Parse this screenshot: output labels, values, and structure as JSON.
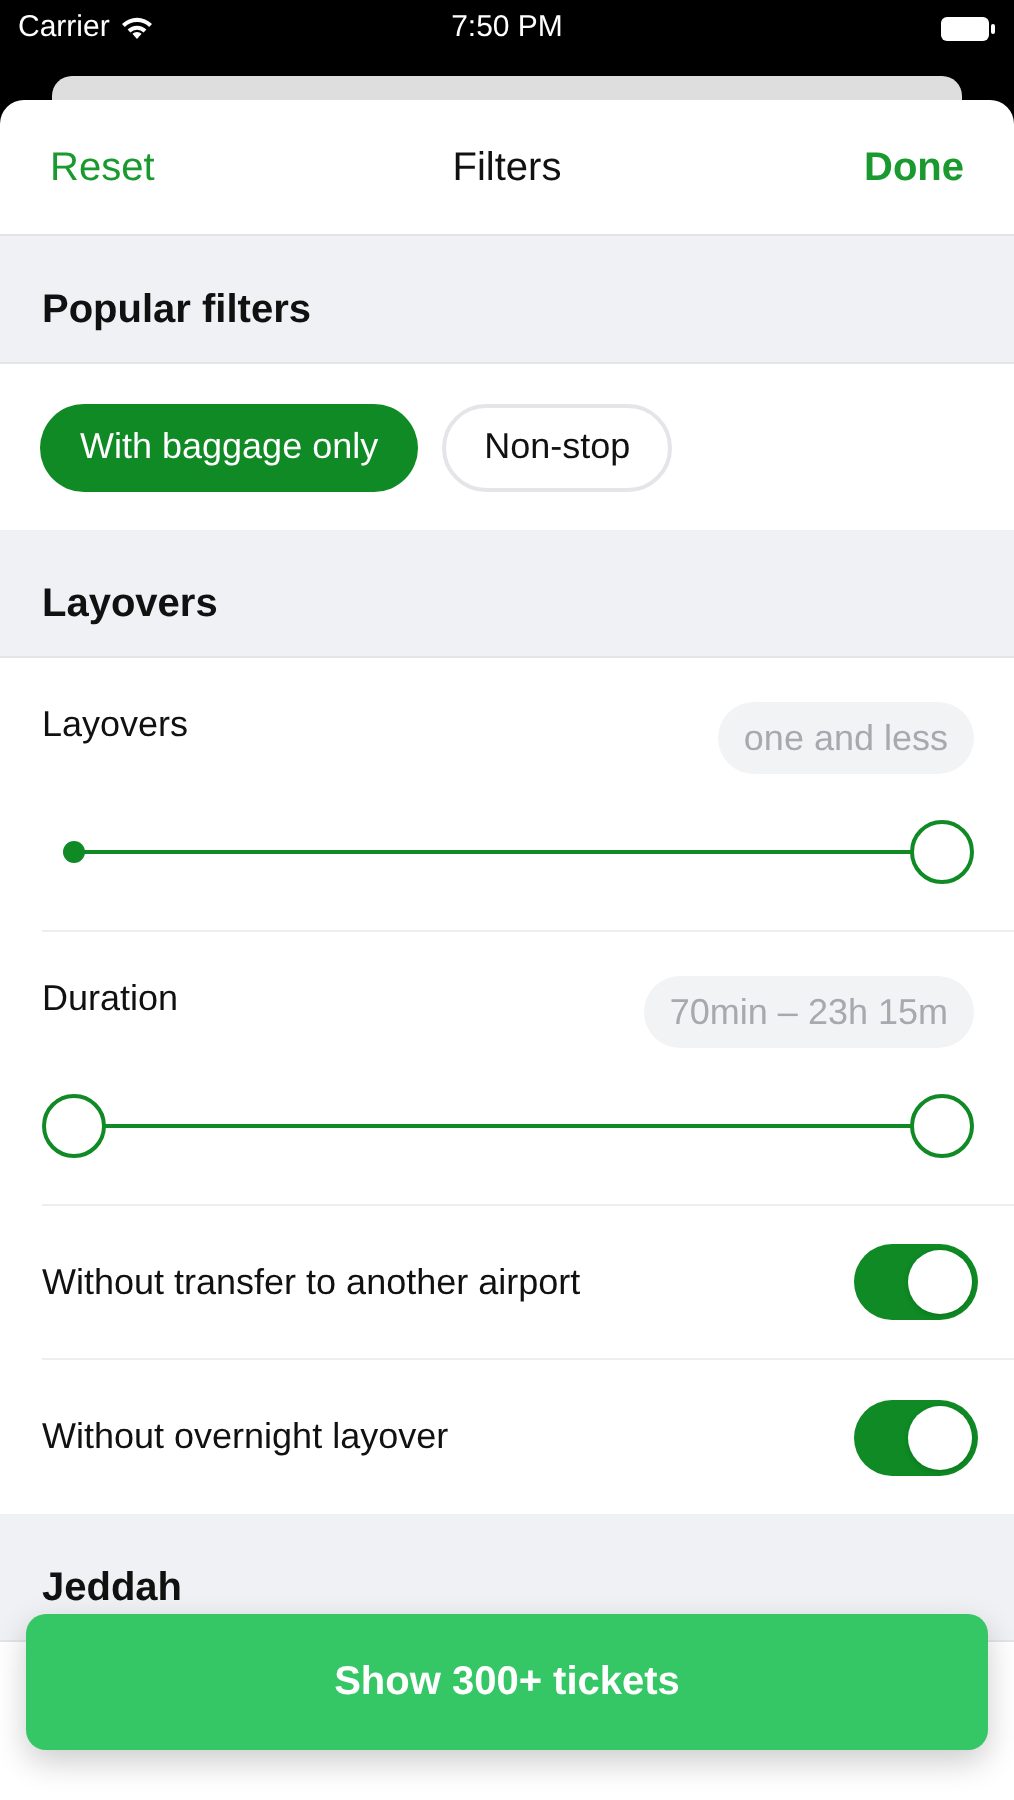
{
  "status_bar": {
    "carrier": "Carrier",
    "time": "7:50 PM"
  },
  "nav": {
    "left": "Reset",
    "title": "Filters",
    "right": "Done"
  },
  "sections": [
    {
      "title": "Popular filters",
      "rows": [
        {
          "kind": "chips",
          "chips": [
            {
              "label": "With baggage only",
              "selected": true
            },
            {
              "label": "Non-stop",
              "selected": false
            }
          ]
        }
      ]
    },
    {
      "title": "Layovers",
      "rows": [
        {
          "kind": "slider",
          "label": "Layovers",
          "value": "one and less",
          "thumbs": [
            {
              "kind": "dot",
              "level": 0
            },
            {
              "kind": "ring",
              "level": 1
            }
          ]
        },
        {
          "kind": "slider",
          "label": "Duration",
          "value": "70min – 23h 15m",
          "thumbs": [
            {
              "kind": "ring",
              "level": 0
            },
            {
              "kind": "ring",
              "level": 1
            }
          ]
        },
        {
          "kind": "toggle",
          "label": "Without transfer to another airport",
          "on": true
        },
        {
          "kind": "toggle",
          "label": "Without overnight layover",
          "on": true
        }
      ]
    },
    {
      "title": "Jeddah"
    }
  ],
  "action_button": "Show 300+ tickets"
}
